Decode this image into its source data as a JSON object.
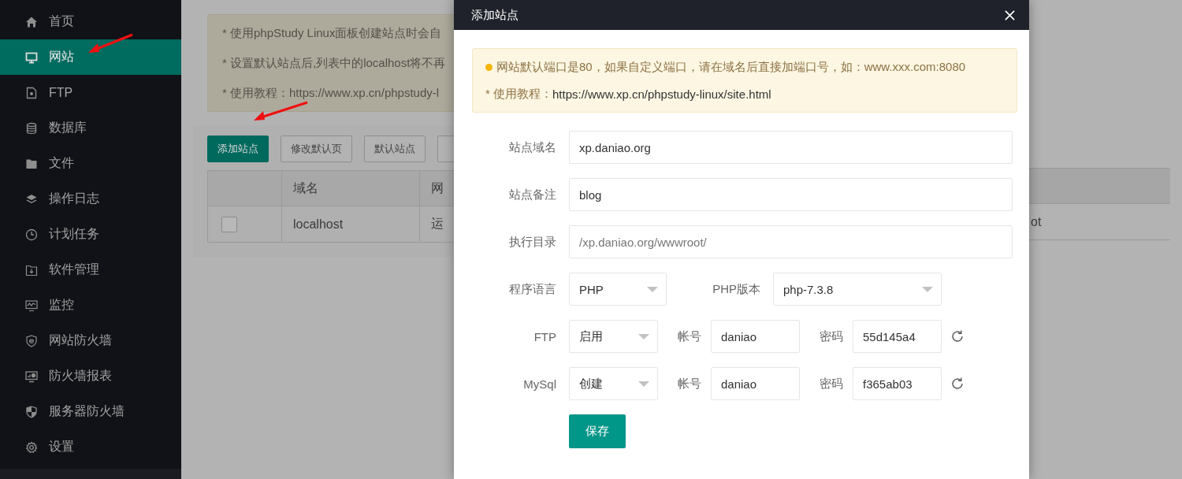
{
  "sidebar": {
    "items": [
      {
        "label": "首页",
        "selected": false
      },
      {
        "label": "网站",
        "selected": true
      },
      {
        "label": "FTP",
        "selected": false
      },
      {
        "label": "数据库",
        "selected": false
      },
      {
        "label": "文件",
        "selected": false
      },
      {
        "label": "操作日志",
        "selected": false
      },
      {
        "label": "计划任务",
        "selected": false
      },
      {
        "label": "软件管理",
        "selected": false
      },
      {
        "label": "监控",
        "selected": false
      },
      {
        "label": "网站防火墙",
        "selected": false
      },
      {
        "label": "防火墙报表",
        "selected": false
      },
      {
        "label": "服务器防火墙",
        "selected": false
      },
      {
        "label": "设置",
        "selected": false
      }
    ]
  },
  "notices": [
    "* 使用phpStudy Linux面板创建站点时会自",
    "* 设置默认站点后,列表中的localhost将不再",
    "* 使用教程：https://www.xp.cn/phpstudy-l"
  ],
  "toolbar_buttons": [
    {
      "label": "添加站点",
      "primary": true
    },
    {
      "label": "修改默认页",
      "primary": false
    },
    {
      "label": "默认站点",
      "primary": false
    }
  ],
  "table": {
    "columns": [
      "域名",
      "网"
    ],
    "rows": [
      {
        "checked": false,
        "cells": [
          "localhost",
          "运"
        ],
        "trailing_cell": "ot"
      }
    ]
  },
  "dialog": {
    "title": "添加站点",
    "alert": [
      {
        "kind": "bullet",
        "text": "网站默认端口是80，如果自定义端口，请在域名后直接加端口号，如：www.xxx.com:8080"
      },
      {
        "kind": "link",
        "text": "* 使用教程：",
        "link": "https://www.xp.cn/phpstudy-linux/site.html"
      }
    ],
    "rows": [
      {
        "kind": "text",
        "label": "站点域名",
        "value": "xp.daniao.org"
      },
      {
        "kind": "text",
        "label": "站点备注",
        "value": "blog"
      },
      {
        "kind": "text",
        "label": "执行目录",
        "placeholder": "/xp.daniao.org/wwwroot/"
      },
      {
        "kind": "language",
        "label": "程序语言",
        "value": "PHP",
        "version_label": "PHP版本",
        "version": "php-7.3.8"
      },
      {
        "kind": "account",
        "label": "FTP",
        "value": "启用",
        "user_label": "帐号",
        "user": "daniao",
        "password_label": "密码",
        "password": "55d145a4"
      },
      {
        "kind": "account",
        "label": "MySql",
        "value": "创建",
        "user_label": "帐号",
        "user": "daniao",
        "password_label": "密码",
        "password": "f365ab03"
      }
    ],
    "save_button": "保存"
  }
}
